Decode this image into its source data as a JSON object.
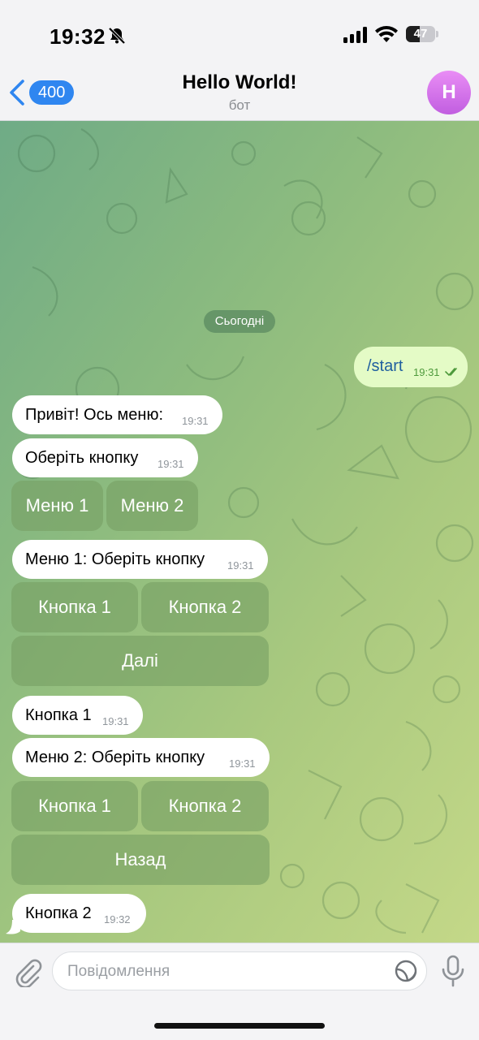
{
  "status_bar": {
    "time": "19:32",
    "battery_level": "47",
    "battery_fraction": 0.47
  },
  "header": {
    "back_count": "400",
    "title": "Hello World!",
    "subtitle": "бот",
    "avatar_letter": "H"
  },
  "chat": {
    "date_label": "Сьогодні",
    "messages": [
      {
        "text": "/start",
        "time": "19:31"
      },
      {
        "text": "Привіт! Ось меню:",
        "time": "19:31"
      },
      {
        "text": "Оберіть кнопку",
        "time": "19:31"
      },
      {
        "text": "Меню 1: Оберіть кнопку",
        "time": "19:31"
      },
      {
        "text": "Кнопка 1",
        "time": "19:31"
      },
      {
        "text": "Меню 2: Оберіть кнопку",
        "time": "19:31"
      },
      {
        "text": "Кнопка 2",
        "time": "19:32"
      }
    ],
    "keyboards": [
      {
        "buttons": [
          "Меню 1",
          "Меню 2"
        ]
      },
      {
        "buttons": [
          "Кнопка 1",
          "Кнопка 2",
          "Далі"
        ]
      },
      {
        "buttons": [
          "Кнопка 1",
          "Кнопка 2",
          "Назад"
        ]
      }
    ]
  },
  "composer": {
    "placeholder": "Повідомлення"
  },
  "colors": {
    "accent": "#2f86f0",
    "outgoing_bubble": "#e4fbc6",
    "avatar": "#d576eb"
  },
  "icons": [
    "bell-slash-icon",
    "signal-icon",
    "wifi-icon",
    "battery-icon",
    "chevron-left-icon",
    "paperclip-icon",
    "sticker-icon",
    "microphone-icon",
    "double-check-icon"
  ]
}
